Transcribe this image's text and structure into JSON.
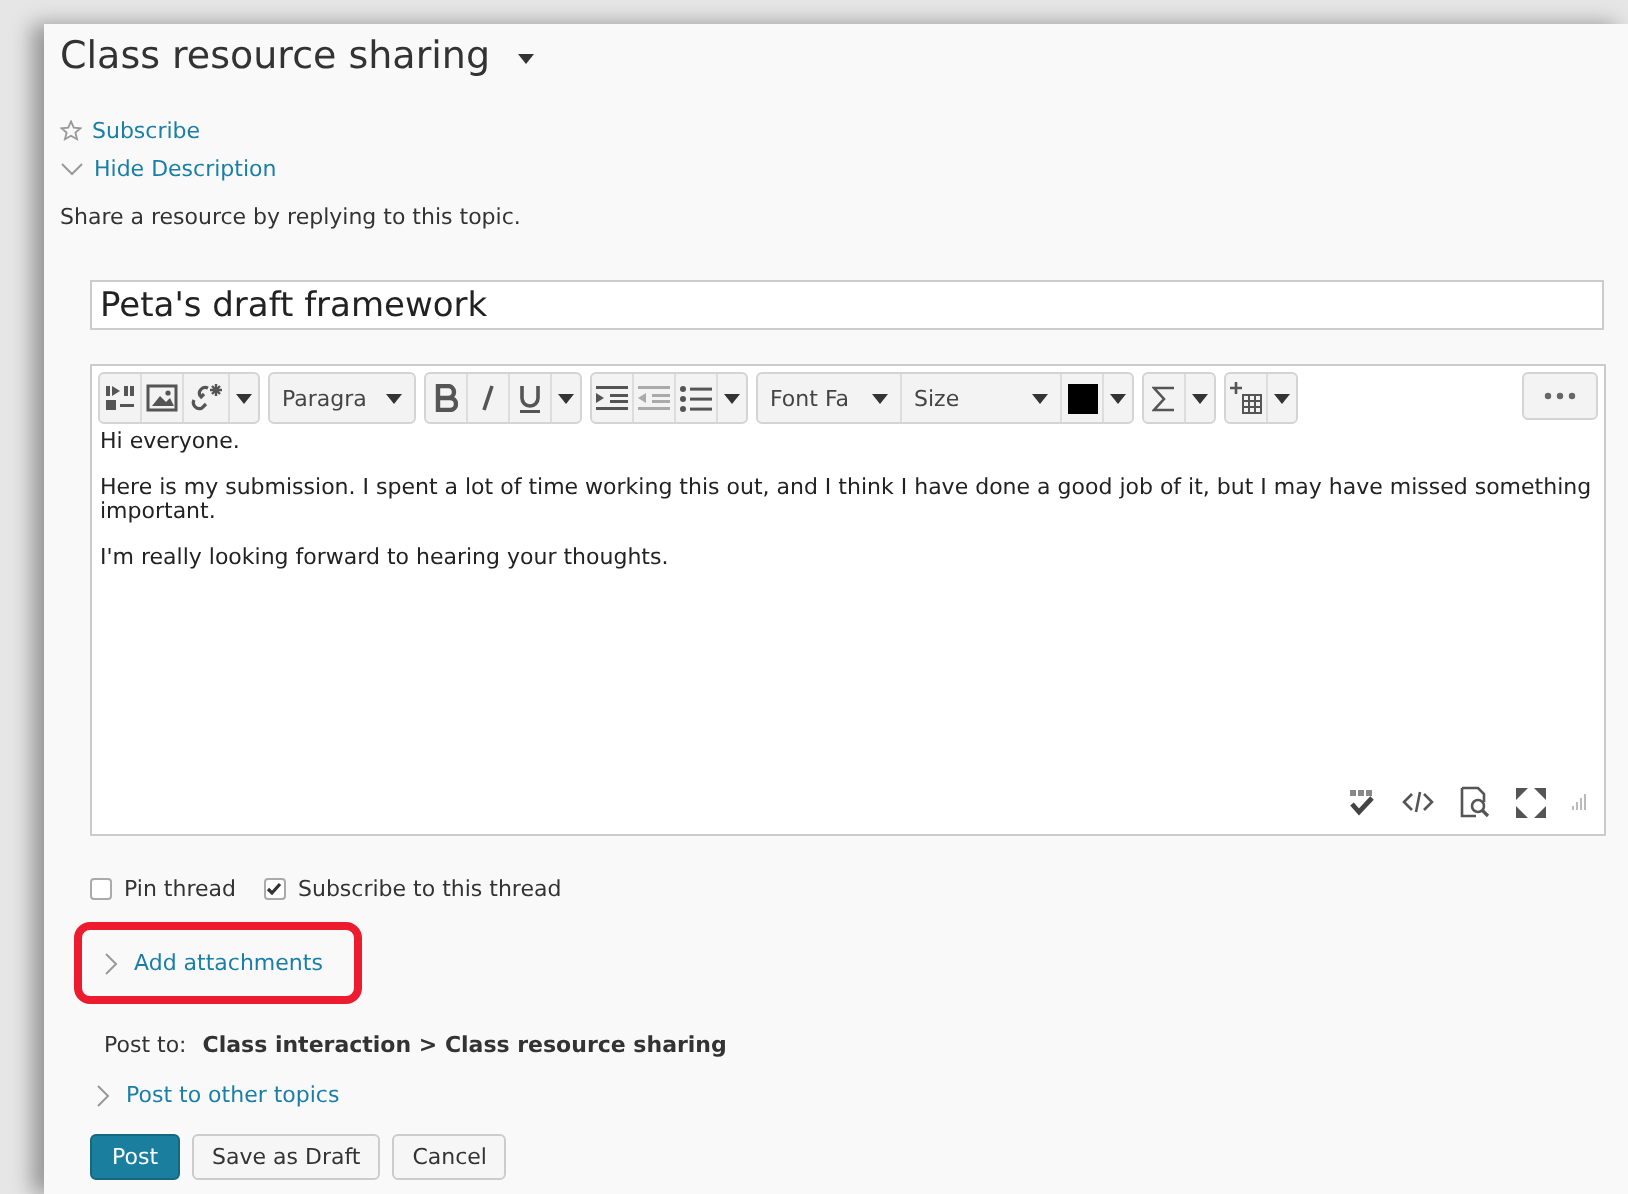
{
  "topic": {
    "title": "Class resource sharing"
  },
  "links": [
    {
      "kind": "star",
      "label": "Subscribe"
    },
    {
      "kind": "chevron-down",
      "label": "Hide Description"
    }
  ],
  "description": "Share a resource by replying to this topic.",
  "subject": {
    "value": "Peta's draft framework"
  },
  "editor": {
    "toolbar": [
      [
        {
          "kind": "media"
        },
        {
          "kind": "image"
        },
        {
          "kind": "link"
        },
        {
          "kind": "caret"
        }
      ],
      [
        {
          "kind": "select",
          "label": "Paragra",
          "wide": false
        }
      ],
      [
        {
          "kind": "bold"
        },
        {
          "kind": "italic"
        },
        {
          "kind": "underline"
        },
        {
          "kind": "caret"
        }
      ],
      [
        {
          "kind": "indent"
        },
        {
          "kind": "outdent"
        },
        {
          "kind": "list"
        },
        {
          "kind": "caret"
        }
      ],
      [
        {
          "kind": "select",
          "label": "Font Fa",
          "wide": false
        },
        {
          "kind": "select",
          "label": "Size",
          "wide": true
        },
        {
          "kind": "swatch",
          "color": "#000000"
        },
        {
          "kind": "caret"
        }
      ],
      [
        {
          "kind": "sigma"
        },
        {
          "kind": "caret"
        }
      ],
      [
        {
          "kind": "table"
        },
        {
          "kind": "caret"
        }
      ]
    ],
    "paragraphs": [
      "Hi everyone.",
      "Here is my submission. I spent a lot of time working this out, and I think I have done a good job of it, but I may have missed something important.",
      "I'm really looking forward to hearing your thoughts."
    ]
  },
  "options": [
    {
      "label": "Pin thread",
      "checked": false
    },
    {
      "label": "Subscribe to this thread",
      "checked": true
    }
  ],
  "attachments": {
    "label": "Add attachments",
    "highlighted": true
  },
  "post_to": {
    "label": "Post to:",
    "path": "Class interaction > Class resource sharing"
  },
  "other_topics": {
    "label": "Post to other topics"
  },
  "buttons": [
    {
      "label": "Post",
      "primary": true
    },
    {
      "label": "Save as Draft",
      "primary": false
    },
    {
      "label": "Cancel",
      "primary": false
    }
  ]
}
